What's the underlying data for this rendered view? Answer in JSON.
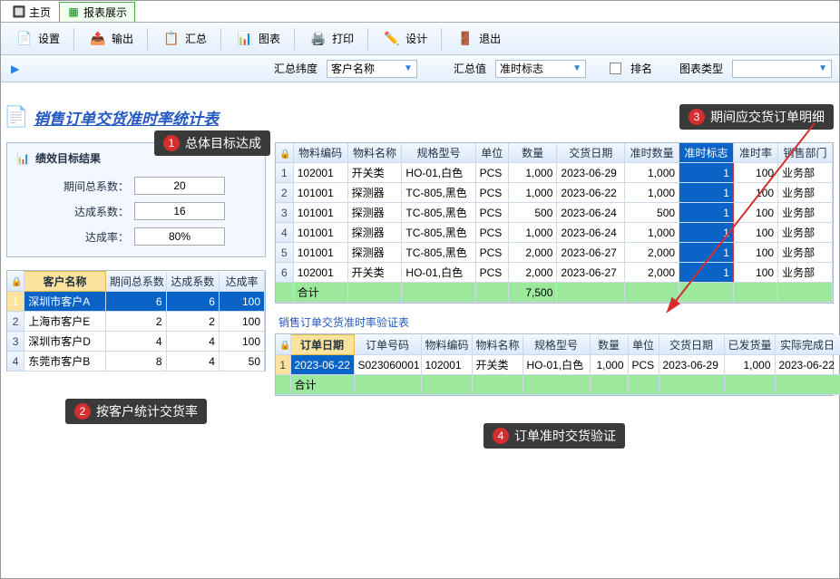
{
  "tabs": {
    "home": "主页",
    "report": "报表展示"
  },
  "toolbar": {
    "settings": "设置",
    "export": "输出",
    "summary": "汇总",
    "chart": "图表",
    "print": "打印",
    "design": "设计",
    "exit": "退出"
  },
  "filter": {
    "dim_label": "汇总纬度",
    "dim_value": "客户名称",
    "val_label": "汇总值",
    "val_value": "准时标志",
    "rank_label": "排名",
    "chart_type_label": "图表类型",
    "chart_type_value": ""
  },
  "title": "销售订单交货准时率统计表",
  "tags": {
    "t1": "总体目标达成",
    "t2": "按客户统计交货率",
    "t3": "期间应交货订单明细",
    "t4": "订单准时交货验证"
  },
  "kpi": {
    "title": "绩效目标结果",
    "rows": [
      {
        "label": "期间总系数：",
        "value": "20"
      },
      {
        "label": "达成系数：",
        "value": "16"
      },
      {
        "label": "达成率：",
        "value": "80%"
      }
    ]
  },
  "leftGrid": {
    "headers": [
      "客户名称",
      "期间总系数",
      "达成系数",
      "达成率"
    ],
    "rows": [
      {
        "c": [
          "深圳市客户A",
          "6",
          "6",
          "100"
        ],
        "sel": true
      },
      {
        "c": [
          "上海市客户E",
          "2",
          "2",
          "100"
        ]
      },
      {
        "c": [
          "深圳市客户D",
          "4",
          "4",
          "100"
        ]
      },
      {
        "c": [
          "东莞市客户B",
          "8",
          "4",
          "50"
        ]
      }
    ]
  },
  "topGrid": {
    "headers": [
      "物料编码",
      "物料名称",
      "规格型号",
      "单位",
      "数量",
      "交货日期",
      "准时数量",
      "准时标志",
      "准时率",
      "销售部门"
    ],
    "hlIndex": 7,
    "rows": [
      [
        "102001",
        "开关类",
        "HO-01,白色",
        "PCS",
        "1,000",
        "2023-06-29",
        "1,000",
        "1",
        "100",
        "业务部"
      ],
      [
        "101001",
        "探测器",
        "TC-805,黑色",
        "PCS",
        "1,000",
        "2023-06-22",
        "1,000",
        "1",
        "100",
        "业务部"
      ],
      [
        "101001",
        "探测器",
        "TC-805,黑色",
        "PCS",
        "500",
        "2023-06-24",
        "500",
        "1",
        "100",
        "业务部"
      ],
      [
        "101001",
        "探测器",
        "TC-805,黑色",
        "PCS",
        "1,000",
        "2023-06-24",
        "1,000",
        "1",
        "100",
        "业务部"
      ],
      [
        "101001",
        "探测器",
        "TC-805,黑色",
        "PCS",
        "2,000",
        "2023-06-27",
        "2,000",
        "1",
        "100",
        "业务部"
      ],
      [
        "102001",
        "开关类",
        "HO-01,白色",
        "PCS",
        "2,000",
        "2023-06-27",
        "2,000",
        "1",
        "100",
        "业务部"
      ]
    ],
    "totals": [
      "合计",
      "",
      "",
      "",
      "7,500",
      "",
      "",
      "",
      "",
      ""
    ]
  },
  "subTitle": "销售订单交货准时率验证表",
  "subGrid": {
    "headers": [
      "订单日期",
      "订单号码",
      "物料编码",
      "物料名称",
      "规格型号",
      "数量",
      "单位",
      "交货日期",
      "已发货量",
      "实际完成日"
    ],
    "rows": [
      [
        "2023-06-22",
        "S023060001",
        "102001",
        "开关类",
        "HO-01,白色",
        "1,000",
        "PCS",
        "2023-06-29",
        "1,000",
        "2023-06-22"
      ]
    ],
    "totals": [
      "合计",
      "",
      "",
      "",
      "",
      "",
      "",
      "",
      "",
      ""
    ]
  }
}
